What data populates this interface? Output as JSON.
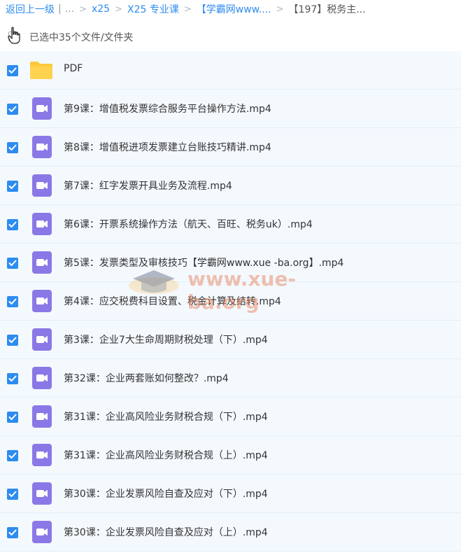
{
  "breadcrumb": {
    "back": "返回上一级",
    "divider": "|",
    "ellipsis": "...",
    "items": [
      "x25",
      "X25 专业课",
      "【学霸网www....",
      "【197】税务主..."
    ]
  },
  "selection": {
    "text": "已选中35个文件/文件夹"
  },
  "files": [
    {
      "name": "PDF",
      "type": "folder"
    },
    {
      "name": "第9课：增值税发票综合服务平台操作方法.mp4",
      "type": "video"
    },
    {
      "name": "第8课：增值税进项发票建立台账技巧精讲.mp4",
      "type": "video"
    },
    {
      "name": "第7课：红字发票开具业务及流程.mp4",
      "type": "video"
    },
    {
      "name": "第6课：开票系统操作方法（航天、百旺、税务uk）.mp4",
      "type": "video"
    },
    {
      "name": "第5课：发票类型及审核技巧【学霸网www.xue -ba.org】.mp4",
      "type": "video"
    },
    {
      "name": "第4课：应交税费科目设置、税金计算及结转.mp4",
      "type": "video"
    },
    {
      "name": "第3课：企业7大生命周期财税处理（下）.mp4",
      "type": "video"
    },
    {
      "name": "第32课：企业两套账如何整改？.mp4",
      "type": "video"
    },
    {
      "name": "第31课：企业高风险业务财税合规（下）.mp4",
      "type": "video"
    },
    {
      "name": "第31课：企业高风险业务财税合规（上）.mp4",
      "type": "video"
    },
    {
      "name": "第30课：企业发票风险自查及应对（下）.mp4",
      "type": "video"
    },
    {
      "name": "第30课：企业发票风险自查及应对（上）.mp4",
      "type": "video"
    }
  ],
  "watermark": {
    "text": "www.xue-ba.org"
  },
  "colors": {
    "accent": "#2d8cf0",
    "folder": "#fcc93c",
    "video": "#8a78e6",
    "row_bg": "#f4f9fe"
  }
}
